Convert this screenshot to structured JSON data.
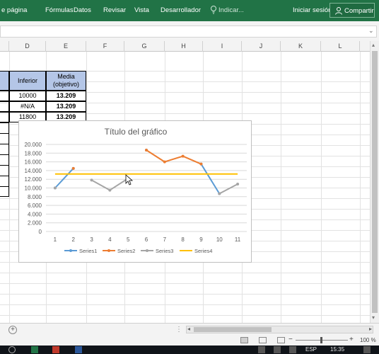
{
  "ribbon": {
    "tabs": [
      "e página",
      "Fórmulas",
      "Datos",
      "Revisar",
      "Vista",
      "Desarrollador"
    ],
    "tell_me": "Indicar...",
    "sign_in": "Iniciar sesión",
    "share": "Compartir"
  },
  "columns": [
    "D",
    "E",
    "F",
    "G",
    "H",
    "I",
    "J",
    "K",
    "L"
  ],
  "table": {
    "headers": [
      "Inferior",
      "Media (objetivo)"
    ],
    "rows": [
      [
        "10000",
        "13.209"
      ],
      [
        "#N/A",
        "13.209"
      ],
      [
        "11800",
        "13.209"
      ]
    ]
  },
  "chart_data": {
    "type": "line",
    "title": "Título del gráfico",
    "x": [
      1,
      2,
      3,
      4,
      5,
      6,
      7,
      8,
      9,
      10,
      11
    ],
    "ylim": [
      0,
      20000
    ],
    "yticks": [
      "0",
      "2.000",
      "4.000",
      "6.000",
      "8.000",
      "10.000",
      "12.000",
      "14.000",
      "16.000",
      "18.000",
      "20.000"
    ],
    "grid": true,
    "legend_position": "bottom",
    "series": [
      {
        "name": "Series1",
        "color": "#5b9bd5",
        "values": [
          10000,
          14500,
          null,
          null,
          null,
          18700,
          null,
          null,
          15500,
          8700,
          null
        ]
      },
      {
        "name": "Series2",
        "color": "#ed7d31",
        "values": [
          null,
          14500,
          null,
          null,
          null,
          18700,
          16000,
          17300,
          15500,
          null,
          null
        ]
      },
      {
        "name": "Series3",
        "color": "#a5a5a5",
        "values": [
          10000,
          null,
          11800,
          9500,
          12200,
          null,
          null,
          null,
          null,
          8700,
          10900
        ]
      },
      {
        "name": "Series4",
        "color": "#ffc000",
        "values": [
          13209,
          13209,
          13209,
          13209,
          13209,
          13209,
          13209,
          13209,
          13209,
          13209,
          13209
        ]
      }
    ]
  },
  "status": {
    "zoom": "100 %"
  },
  "taskbar": {
    "lang": "ESP",
    "time": "15:35"
  }
}
